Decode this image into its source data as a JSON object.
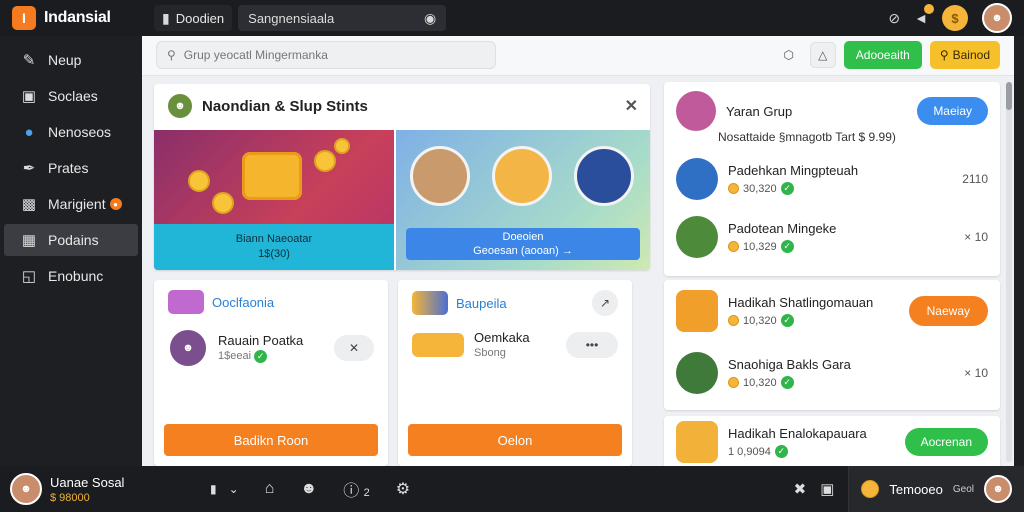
{
  "app": {
    "name": "Indansial",
    "logo_glyph": "I"
  },
  "topbar": {
    "tab_label": "Doodien",
    "search_text": "Sangnensiaala",
    "coin_glyph": "$"
  },
  "sidebar": {
    "items": [
      {
        "label": "Neup",
        "icon": "pencil-icon"
      },
      {
        "label": "Soclaes",
        "icon": "folder-icon"
      },
      {
        "label": "Nenoseos",
        "icon": "globe-icon"
      },
      {
        "label": "Prates",
        "icon": "pen-icon"
      },
      {
        "label": "Marigient",
        "icon": "document-icon"
      },
      {
        "label": "Podains",
        "icon": "box-icon"
      },
      {
        "label": "Enobunc",
        "icon": "window-icon"
      }
    ]
  },
  "searchbar": {
    "placeholder": "Grup yeocatl Mingermanka",
    "green_button": "Adooeaith",
    "yellow_button": "Bainod"
  },
  "feature": {
    "title": "Naondian & Slup Stints",
    "banner1_title": "Biann Naeoatar",
    "banner1_sub": "1$(30)",
    "banner2_title": "Doeoien",
    "banner2_sub": "Geoesan (aooan) →"
  },
  "card_left": {
    "header": "Ooclfaonia",
    "name": "Rauain Poatka",
    "sub": "1$eeai",
    "button": "Badikn Roon"
  },
  "card_mid": {
    "header": "Baupeila",
    "name": "Oemkaka",
    "sub": "Sbong",
    "button": "Oelon"
  },
  "right": {
    "top": {
      "title": "Yaran Grup",
      "button": "Maeiay",
      "note": "Nosattaide §mnagotb Tart $ 9.99)"
    },
    "rows": [
      {
        "title": "Padehkan Mingpteuah",
        "sub": "30,320",
        "right": "2110"
      },
      {
        "title": "Padotean Mingeke",
        "sub": "10,329",
        "right": "× 10"
      },
      {
        "title": "Hadikah Shatlingomauan",
        "sub": "10,320",
        "button": "Naeway"
      },
      {
        "title": "Snaohiga Bakls Gara",
        "sub": "10,320",
        "right": "× 10"
      },
      {
        "title": "Hadikah Enalokapauara",
        "sub": "1 0,9094",
        "button": "Aocrenan"
      }
    ]
  },
  "bottombar": {
    "user_name": "Uanae Sosal",
    "user_coins": "$ 98000",
    "count": "2",
    "chat_label": "Temooeo",
    "right_label": "Geol"
  },
  "colors": {
    "accent_orange": "#f4801f",
    "accent_green": "#2fbf4a",
    "accent_blue": "#3b8ef0",
    "accent_yellow": "#f6c02a"
  }
}
